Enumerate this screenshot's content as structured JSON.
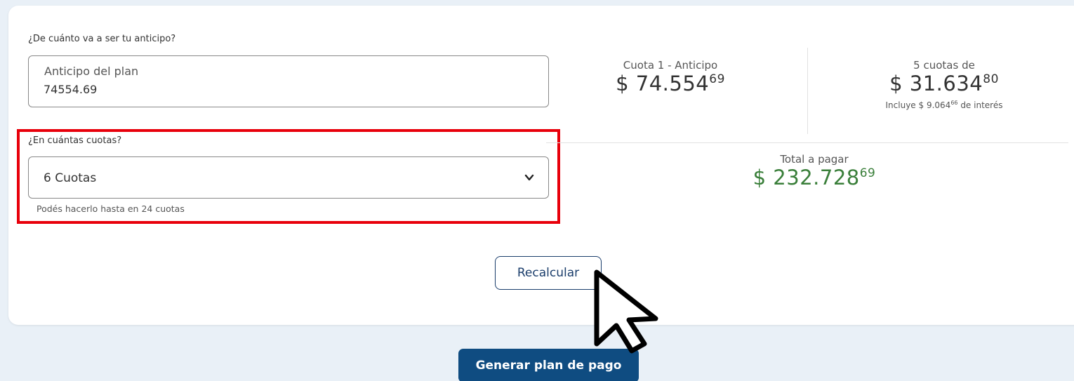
{
  "form": {
    "anticipo_question": "¿De cuánto va a ser tu anticipo?",
    "anticipo_label": "Anticipo del plan",
    "anticipo_value": "74554.69",
    "cuotas_question": "¿En cuántas cuotas?",
    "cuotas_selected": "6 Cuotas",
    "cuotas_helper": "Podés hacerlo hasta en 24 cuotas"
  },
  "summary": {
    "cuota1_title": "Cuota 1 - Anticipo",
    "cuota1_amount_int": "$ 74.554",
    "cuota1_amount_dec": "69",
    "cuotas_title": "5 cuotas de",
    "cuotas_amount_int": "$ 31.634",
    "cuotas_amount_dec": "80",
    "interes_prefix": "Incluye $ 9.064",
    "interes_dec": "66",
    "interes_suffix": " de interés",
    "total_title": "Total a pagar",
    "total_amount_int": "$ 232.728",
    "total_amount_dec": "69"
  },
  "actions": {
    "recalcular_label": "Recalcular",
    "generar_label": "Generar plan de pago"
  },
  "colors": {
    "primary": "#0f4c81",
    "highlight": "#e8000b",
    "total_green": "#3a7f3a",
    "background": "#e9f0f7"
  },
  "icons": {
    "select_arrow": "chevron-down-icon",
    "cursor": "mouse-pointer-icon"
  }
}
